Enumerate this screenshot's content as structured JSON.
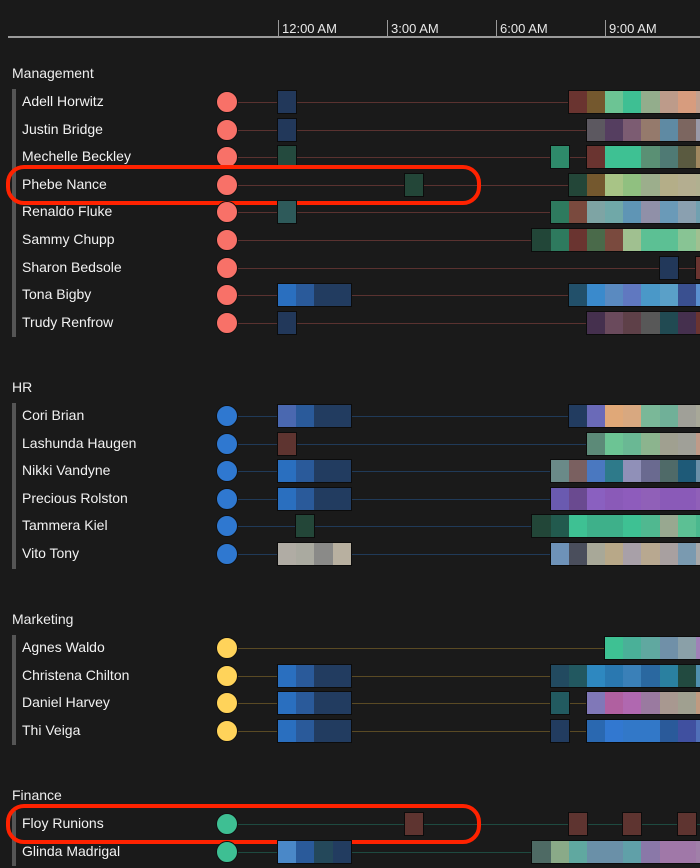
{
  "axis": {
    "ticks": [
      {
        "label": "12:00 AM",
        "slot": 0
      },
      {
        "label": "3:00 AM",
        "slot": 6
      },
      {
        "label": "6:00 AM",
        "slot": 12
      },
      {
        "label": "9:00 AM",
        "slot": 18
      }
    ],
    "slot_minutes": 30
  },
  "groups": [
    {
      "name": "Management",
      "color": "#f87168",
      "line_color": "#5a3230",
      "people": [
        {
          "name": "Adell Horwitz",
          "cells": [
            [
              0,
              "#22385a"
            ],
            [
              16,
              "#6a3430"
            ],
            [
              17,
              "#74582e"
            ],
            [
              18,
              "#6cc494"
            ],
            [
              19,
              "#3ebf93"
            ],
            [
              20,
              "#93ad8c"
            ],
            [
              21,
              "#bd9b8a"
            ],
            [
              22,
              "#d79c7e"
            ],
            [
              23,
              "#c0a090"
            ]
          ]
        },
        {
          "name": "Justin Bridge",
          "cells": [
            [
              0,
              "#22385a"
            ],
            [
              17,
              "#5c5860"
            ],
            [
              18,
              "#553e60"
            ],
            [
              19,
              "#7c5c72"
            ],
            [
              20,
              "#957a6c"
            ],
            [
              21,
              "#5f8aa3"
            ],
            [
              22,
              "#7c6660"
            ],
            [
              23,
              "#9a9aa8"
            ]
          ]
        },
        {
          "name": "Mechelle Beckley",
          "cells": [
            [
              0,
              "#244a3e"
            ],
            [
              15,
              "#2e8a6a"
            ],
            [
              17,
              "#6a3430"
            ],
            [
              18,
              "#3ec193"
            ],
            [
              19,
              "#3ec193"
            ],
            [
              20,
              "#5a9074"
            ],
            [
              21,
              "#4f7a74"
            ],
            [
              22,
              "#5a5a40"
            ],
            [
              23,
              "#a08860"
            ]
          ]
        },
        {
          "name": "Phebe Nance",
          "cells": [
            [
              7,
              "#234638"
            ],
            [
              16,
              "#234638"
            ],
            [
              17,
              "#74582e"
            ],
            [
              18,
              "#a8c486"
            ],
            [
              19,
              "#90c080"
            ],
            [
              20,
              "#9cae8c"
            ],
            [
              21,
              "#b4ae88"
            ],
            [
              22,
              "#b4ae90"
            ],
            [
              23,
              "#b0b090"
            ]
          ],
          "highlighted": true
        },
        {
          "name": "Renaldo Fluke",
          "cells": [
            [
              0,
              "#2e5a5a"
            ],
            [
              15,
              "#2e7a5e"
            ],
            [
              16,
              "#7a4a3e"
            ],
            [
              17,
              "#7ea4a4"
            ],
            [
              18,
              "#70a8a8"
            ],
            [
              19,
              "#5f95b5"
            ],
            [
              20,
              "#9090a8"
            ],
            [
              21,
              "#6a9ab8"
            ],
            [
              22,
              "#8aa0b0"
            ],
            [
              23,
              "#70a0b0"
            ]
          ]
        },
        {
          "name": "Sammy Chupp",
          "cells": [
            [
              14,
              "#224638"
            ],
            [
              15,
              "#2e7a5e"
            ],
            [
              16,
              "#6a3430"
            ],
            [
              17,
              "#4a6a4a"
            ],
            [
              18,
              "#7a4a3e"
            ],
            [
              19,
              "#a0c090"
            ],
            [
              20,
              "#5cc094"
            ],
            [
              21,
              "#5cc094"
            ],
            [
              22,
              "#88c494"
            ],
            [
              23,
              "#a0c090"
            ]
          ]
        },
        {
          "name": "Sharon Bedsole",
          "cells": [
            [
              21,
              "#22385a"
            ],
            [
              23,
              "#6a3430"
            ]
          ]
        },
        {
          "name": "Tona Bigby",
          "cells": [
            [
              0,
              "#2a6fbf"
            ],
            [
              1,
              "#2a5a9a"
            ],
            [
              2,
              "#223c60"
            ],
            [
              3,
              "#223c60"
            ],
            [
              16,
              "#22506a"
            ],
            [
              17,
              "#3a8acc"
            ],
            [
              18,
              "#5a8ac0"
            ],
            [
              19,
              "#6078c0"
            ],
            [
              20,
              "#4a98c8"
            ],
            [
              21,
              "#5aa0c8"
            ],
            [
              22,
              "#3a5090"
            ],
            [
              23,
              "#5a90d0"
            ]
          ]
        },
        {
          "name": "Trudy Renfrow",
          "cells": [
            [
              0,
              "#22385a"
            ],
            [
              17,
              "#45304e"
            ],
            [
              18,
              "#6a4a5c"
            ],
            [
              19,
              "#5e4048"
            ],
            [
              20,
              "#585858"
            ],
            [
              21,
              "#214a52"
            ],
            [
              22,
              "#45304e"
            ],
            [
              23,
              "#6a3430"
            ]
          ]
        }
      ]
    },
    {
      "name": "HR",
      "color": "#2f78d0",
      "line_color": "#203a58",
      "people": [
        {
          "name": "Cori Brian",
          "cells": [
            [
              0,
              "#4a68b0"
            ],
            [
              1,
              "#2a5a9a"
            ],
            [
              2,
              "#223c60"
            ],
            [
              3,
              "#223c60"
            ],
            [
              16,
              "#223c60"
            ],
            [
              17,
              "#6a6ab8"
            ],
            [
              18,
              "#e0a878"
            ],
            [
              19,
              "#d8a880"
            ],
            [
              20,
              "#7ab898"
            ],
            [
              21,
              "#70b098"
            ],
            [
              22,
              "#a0a098"
            ],
            [
              23,
              "#a8a898"
            ]
          ]
        },
        {
          "name": "Lashunda Haugen",
          "cells": [
            [
              0,
              "#5e3430"
            ],
            [
              17,
              "#5c8a78"
            ],
            [
              18,
              "#6cc494"
            ],
            [
              19,
              "#6ab894"
            ],
            [
              20,
              "#8cb48e"
            ],
            [
              21,
              "#a0a090"
            ],
            [
              22,
              "#a0a098"
            ],
            [
              23,
              "#c09a88"
            ]
          ]
        },
        {
          "name": "Nikki Vandyne",
          "cells": [
            [
              0,
              "#2a6fbf"
            ],
            [
              1,
              "#2a5a9a"
            ],
            [
              2,
              "#223c60"
            ],
            [
              3,
              "#223c60"
            ],
            [
              15,
              "#6a8a88"
            ],
            [
              16,
              "#7a6060"
            ],
            [
              17,
              "#4a78c0"
            ],
            [
              18,
              "#2e7a8a"
            ],
            [
              19,
              "#9090b8"
            ],
            [
              20,
              "#6a6a90"
            ],
            [
              21,
              "#4f6a68"
            ],
            [
              22,
              "#1e5a78"
            ],
            [
              23,
              "#6a90a8"
            ]
          ]
        },
        {
          "name": "Precious Rolston",
          "cells": [
            [
              0,
              "#2a6fbf"
            ],
            [
              1,
              "#2a5a9a"
            ],
            [
              2,
              "#223c60"
            ],
            [
              3,
              "#223c60"
            ],
            [
              15,
              "#6a5ab0"
            ],
            [
              16,
              "#6a4a90"
            ],
            [
              17,
              "#8a60c0"
            ],
            [
              18,
              "#8a5ab8"
            ],
            [
              19,
              "#8e5cbc"
            ],
            [
              20,
              "#9060b8"
            ],
            [
              21,
              "#8a5ab8"
            ],
            [
              22,
              "#8a5ab8"
            ],
            [
              23,
              "#9060b8"
            ]
          ]
        },
        {
          "name": "Tammera Kiel",
          "cells": [
            [
              1,
              "#234638"
            ],
            [
              14,
              "#224638"
            ],
            [
              15,
              "#225a4e"
            ],
            [
              16,
              "#3ec193"
            ],
            [
              17,
              "#3eb08a"
            ],
            [
              18,
              "#3eb08a"
            ],
            [
              19,
              "#3ec193"
            ],
            [
              20,
              "#50b890"
            ],
            [
              21,
              "#98a890"
            ],
            [
              22,
              "#5cc094"
            ],
            [
              23,
              "#4ab88e"
            ]
          ]
        },
        {
          "name": "Vito Tony",
          "cells": [
            [
              0,
              "#b0aca4"
            ],
            [
              1,
              "#aaaaa0"
            ],
            [
              2,
              "#8a8a88"
            ],
            [
              3,
              "#b8b0a0"
            ],
            [
              15,
              "#6e92b8"
            ],
            [
              16,
              "#4a4e5c"
            ],
            [
              17,
              "#a8a898"
            ],
            [
              18,
              "#b8a888"
            ],
            [
              19,
              "#a8a0a8"
            ],
            [
              20,
              "#b8a890"
            ],
            [
              21,
              "#a8a0a0"
            ],
            [
              22,
              "#7a9ab0"
            ],
            [
              23,
              "#a8a8a8"
            ]
          ]
        }
      ]
    },
    {
      "name": "Marketing",
      "color": "#ffd35a",
      "line_color": "#5a4a24",
      "people": [
        {
          "name": "Agnes Waldo",
          "cells": [
            [
              18,
              "#3ec193"
            ],
            [
              19,
              "#4ab098"
            ],
            [
              20,
              "#60a8a0"
            ],
            [
              21,
              "#7090a8"
            ],
            [
              22,
              "#8aa0a8"
            ],
            [
              23,
              "#a080b8"
            ]
          ]
        },
        {
          "name": "Christena Chilton",
          "cells": [
            [
              0,
              "#2a6fbf"
            ],
            [
              1,
              "#2a5a9a"
            ],
            [
              2,
              "#223c60"
            ],
            [
              3,
              "#223c60"
            ],
            [
              15,
              "#224a60"
            ],
            [
              16,
              "#225860"
            ],
            [
              17,
              "#2e88c0"
            ],
            [
              18,
              "#2a78b0"
            ],
            [
              19,
              "#3a80b8"
            ],
            [
              20,
              "#2a68a0"
            ],
            [
              21,
              "#2a80a0"
            ],
            [
              22,
              "#224a40"
            ],
            [
              23,
              "#5090b0"
            ]
          ]
        },
        {
          "name": "Daniel Harvey",
          "cells": [
            [
              0,
              "#2a6fbf"
            ],
            [
              1,
              "#2a5a9a"
            ],
            [
              2,
              "#223c60"
            ],
            [
              3,
              "#223c60"
            ],
            [
              15,
              "#225a60"
            ],
            [
              17,
              "#8078b8"
            ],
            [
              18,
              "#b060a0"
            ],
            [
              19,
              "#b068b0"
            ],
            [
              20,
              "#9a7aa0"
            ],
            [
              21,
              "#a89890"
            ],
            [
              22,
              "#a0a090"
            ],
            [
              23,
              "#c09a80"
            ]
          ]
        },
        {
          "name": "Thi Veiga",
          "cells": [
            [
              0,
              "#2a6fbf"
            ],
            [
              1,
              "#2a5a9a"
            ],
            [
              2,
              "#223c60"
            ],
            [
              3,
              "#223c60"
            ],
            [
              15,
              "#223c60"
            ],
            [
              17,
              "#2a68b0"
            ],
            [
              18,
              "#3278d0"
            ],
            [
              19,
              "#3278c8"
            ],
            [
              20,
              "#3278c8"
            ],
            [
              21,
              "#2a5a9a"
            ],
            [
              22,
              "#4050a0"
            ],
            [
              23,
              "#5070b8"
            ]
          ]
        }
      ]
    },
    {
      "name": "Finance",
      "color": "#3ebf93",
      "line_color": "#1e4a40",
      "people": [
        {
          "name": "Floy Runions",
          "cells": [
            [
              7,
              "#5e3430"
            ],
            [
              16,
              "#5e3430"
            ],
            [
              19,
              "#5e3430"
            ],
            [
              22,
              "#5e3430"
            ]
          ],
          "highlighted": true
        },
        {
          "name": "Glinda Madrigal",
          "cells": [
            [
              0,
              "#4a88c8"
            ],
            [
              1,
              "#2a5a9a"
            ],
            [
              2,
              "#24485a"
            ],
            [
              3,
              "#223c60"
            ],
            [
              14,
              "#4e6a64"
            ],
            [
              15,
              "#8aaa88"
            ],
            [
              16,
              "#60a8a0"
            ],
            [
              17,
              "#6a90a8"
            ],
            [
              18,
              "#6a90a8"
            ],
            [
              19,
              "#60a0a8"
            ],
            [
              20,
              "#8a78a8"
            ],
            [
              21,
              "#a078a8"
            ],
            [
              22,
              "#a078a8"
            ],
            [
              23,
              "#a080a8"
            ]
          ]
        }
      ]
    }
  ]
}
